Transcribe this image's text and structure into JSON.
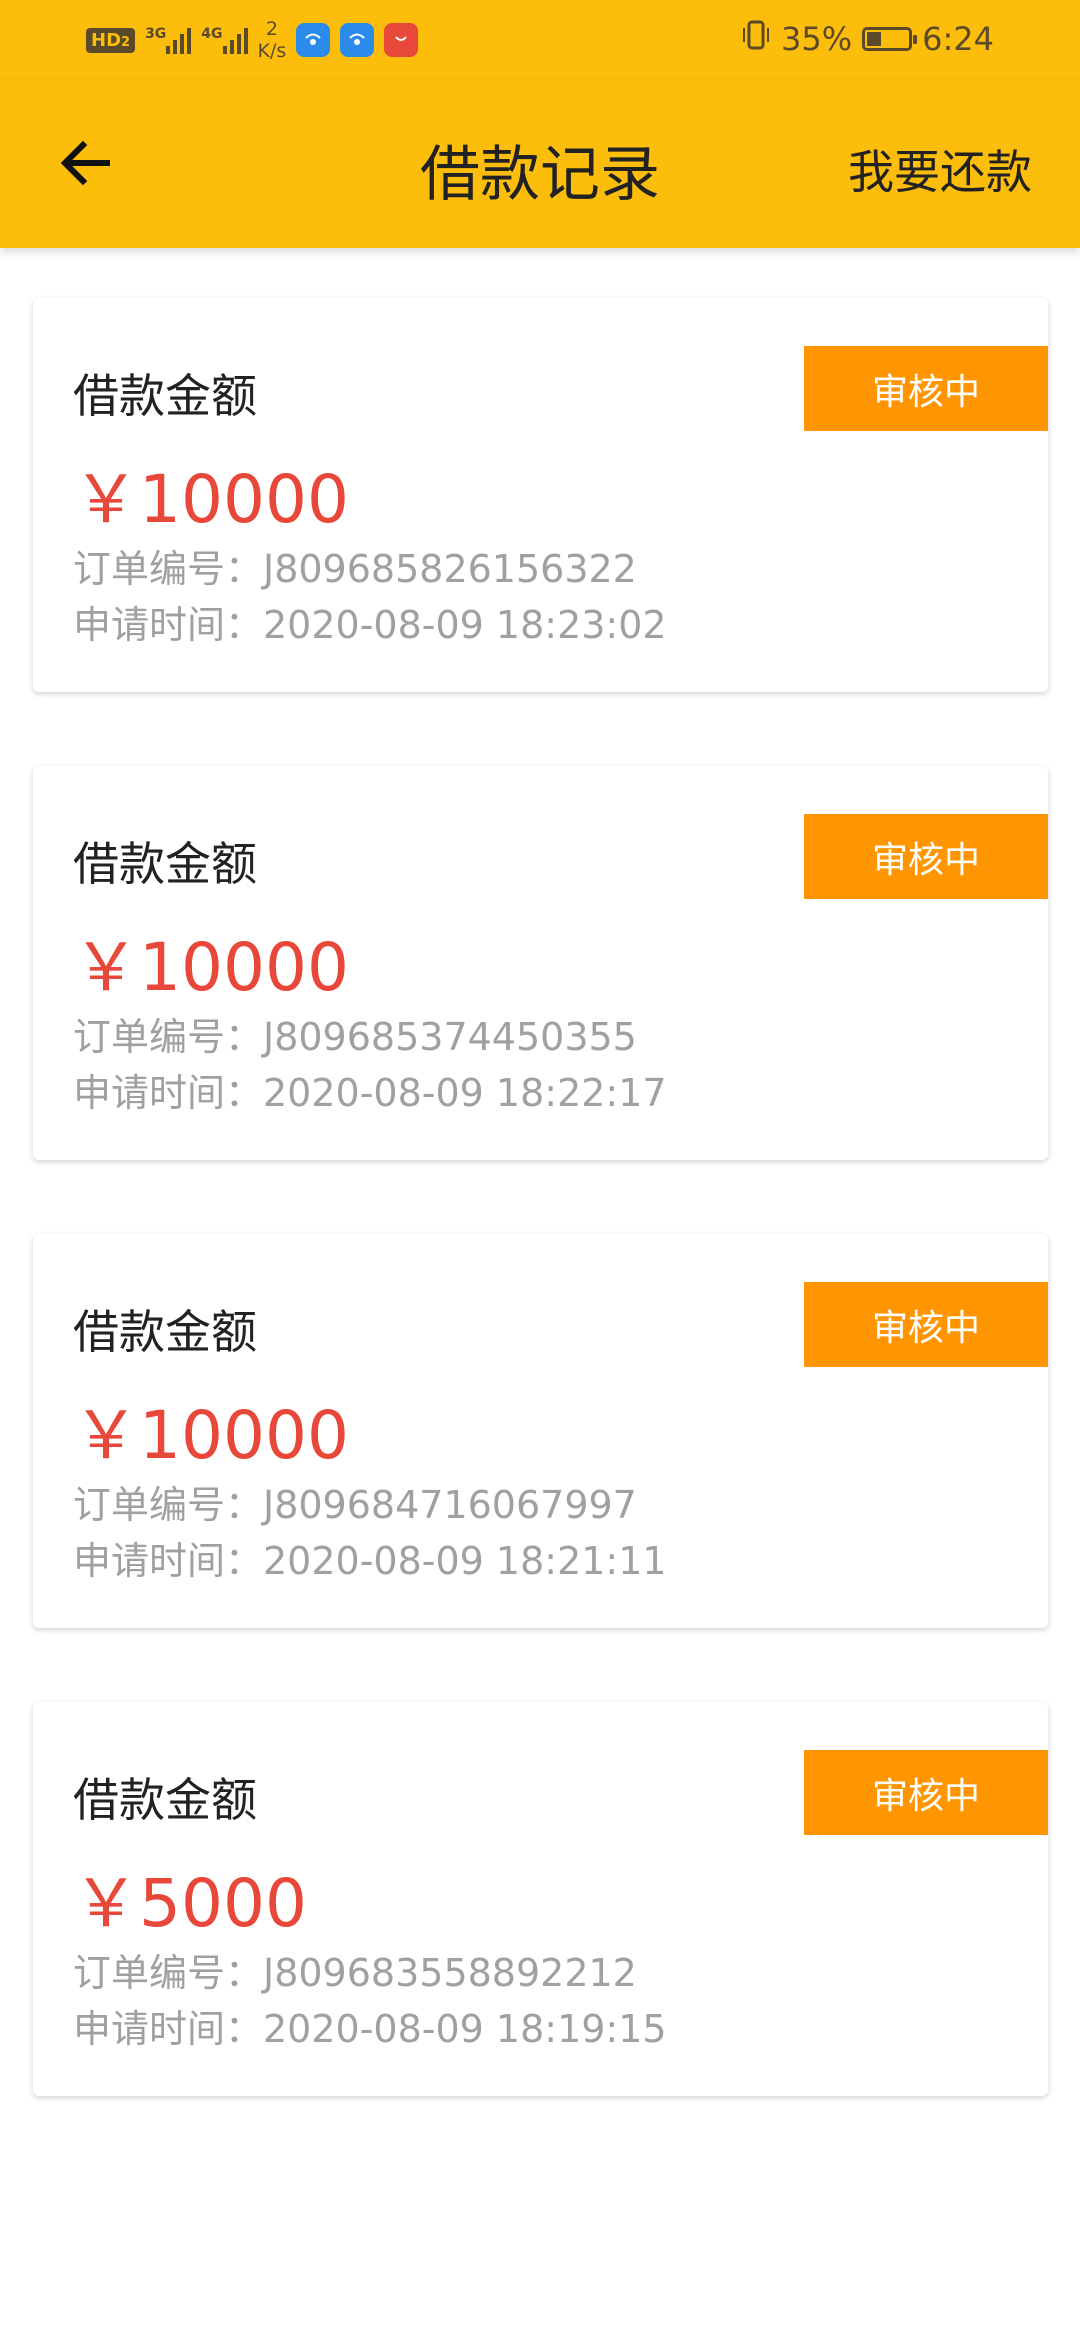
{
  "status_bar": {
    "hd": "HD",
    "hd_sub": "2",
    "net_1": "3G",
    "net_2": "4G",
    "speed_value": "2",
    "speed_unit": "K/s",
    "battery": "35%",
    "time": "6:24",
    "battery_level": 0.35
  },
  "header": {
    "title": "借款记录",
    "action_label": "我要还款"
  },
  "records": [
    {
      "label": "借款金额",
      "amount": "￥10000",
      "order": "订单编号：J809685826156322",
      "time": "申请时间：2020-08-09 18:23:02",
      "status": "审核中"
    },
    {
      "label": "借款金额",
      "amount": "￥10000",
      "order": "订单编号：J809685374450355",
      "time": "申请时间：2020-08-09 18:22:17",
      "status": "审核中"
    },
    {
      "label": "借款金额",
      "amount": "￥10000",
      "order": "订单编号：J809684716067997",
      "time": "申请时间：2020-08-09 18:21:11",
      "status": "审核中"
    },
    {
      "label": "借款金额",
      "amount": "￥5000",
      "order": "订单编号：J809683558892212",
      "time": "申请时间：2020-08-09 18:19:15",
      "status": "审核中"
    }
  ],
  "colors": {
    "header_bg": "#FDBE0B",
    "status_tag_bg": "#FF9500",
    "amount_color": "#E8483A",
    "meta_text_color": "#A0A0A0"
  }
}
